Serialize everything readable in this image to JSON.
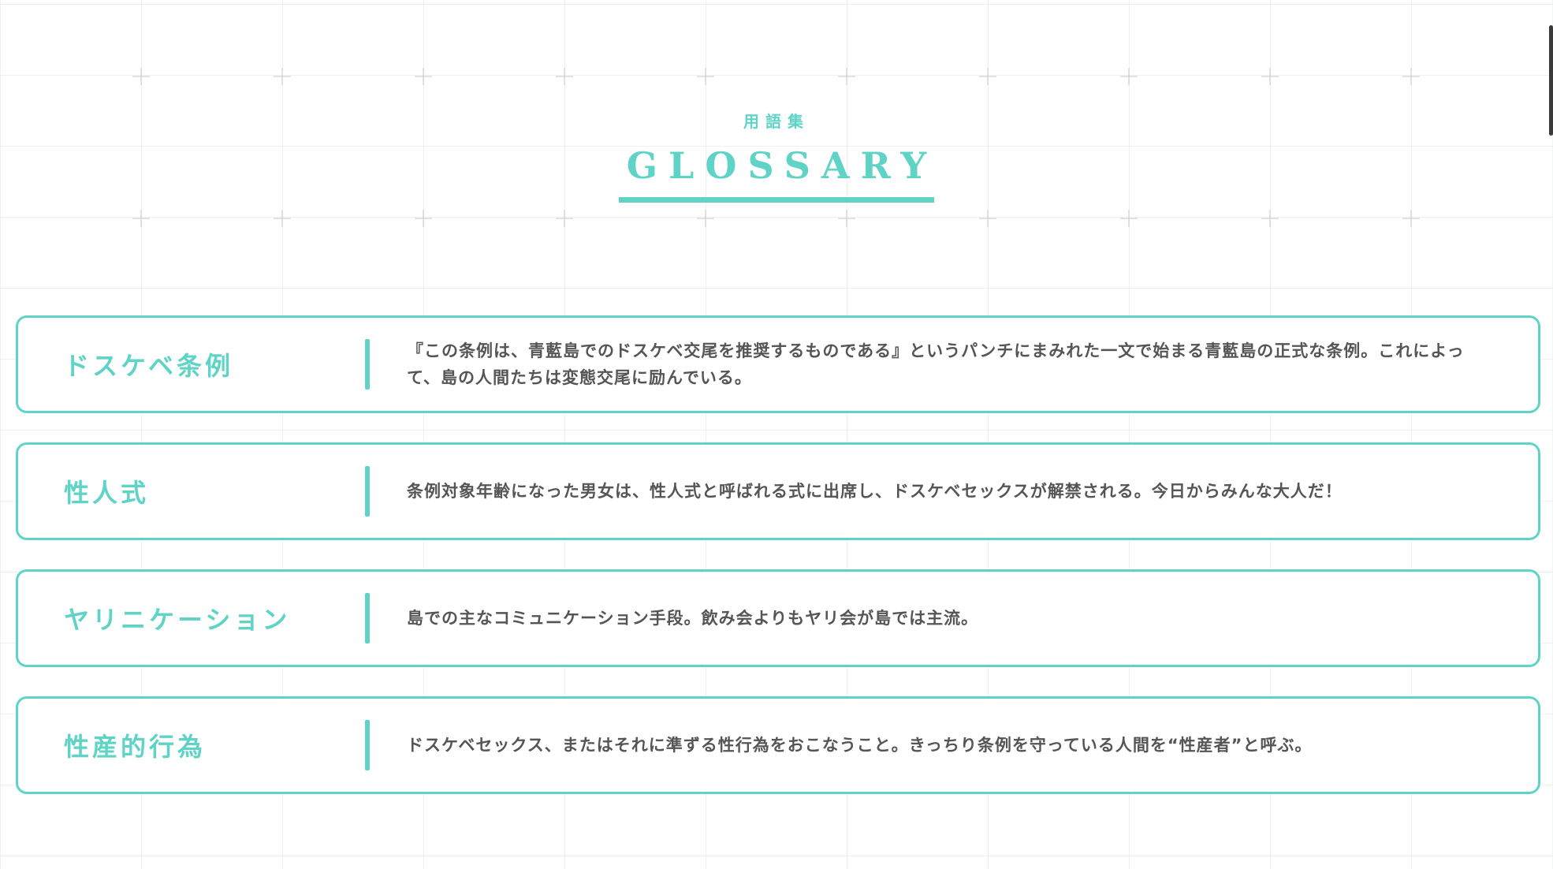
{
  "header": {
    "subtitle": "用語集",
    "title": "GLOSSARY"
  },
  "glossary": {
    "items": [
      {
        "term": "ドスケベ条例",
        "definition": "『この条例は、青藍島でのドスケベ交尾を推奨するものである』というパンチにまみれた一文で始まる青藍島の正式な条例。これによって、島の人間たちは変態交尾に励んでいる。"
      },
      {
        "term": "性人式",
        "definition": "条例対象年齢になった男女は、性人式と呼ばれる式に出席し、ドスケベセックスが解禁される。今日からみんな大人だ！"
      },
      {
        "term": "ヤリニケーション",
        "definition": "島での主なコミュニケーション手段。飲み会よりもヤリ会が島では主流。"
      },
      {
        "term": "性産的行為",
        "definition": "ドスケベセックス、またはそれに準ずる性行為をおこなうこと。きっちり条例を守っている人間を“性産者”と呼ぶ。"
      }
    ]
  },
  "colors": {
    "accent": "#5fd4c6",
    "text": "#555555",
    "background": "#ffffff"
  }
}
